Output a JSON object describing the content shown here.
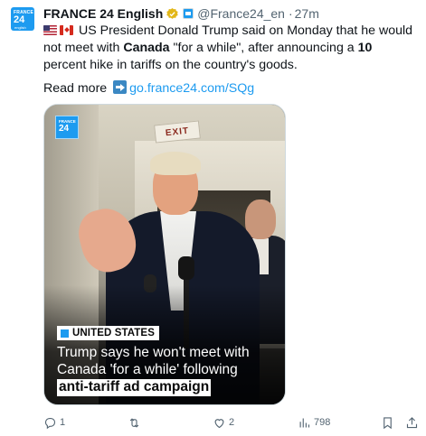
{
  "author": {
    "avatar_line1": "FRANCE",
    "avatar_line2": "24",
    "avatar_line3": "english",
    "display_name": "FRANCE 24 English",
    "handle": "@France24_en",
    "separator": "·",
    "time": "27m"
  },
  "tweet": {
    "text_part1": "US President Donald Trump said on Monday that he would not meet with ",
    "text_bold_canada": "Canada",
    "text_part2": " \"for a while\", after announcing a ",
    "text_bold_10": "10",
    "text_part3": " percent hike in tariffs on the country's goods.",
    "read_more_label": "Read more",
    "link_text": "go.france24.com/SQg"
  },
  "media": {
    "logo_line1": "FRANCE",
    "logo_line2": "24",
    "exit_sign": "EXIT",
    "tag": "UNITED STATES",
    "headline_line1": "Trump says he won't meet with",
    "headline_line2": "Canada 'for a while' following",
    "headline_line3": "anti-tariff ad campaign"
  },
  "actions": {
    "replies": "1",
    "reposts": "",
    "likes": "2",
    "views": "798"
  },
  "colors": {
    "accent": "#1d9bf0",
    "text": "#0f1419",
    "muted": "#536471"
  }
}
